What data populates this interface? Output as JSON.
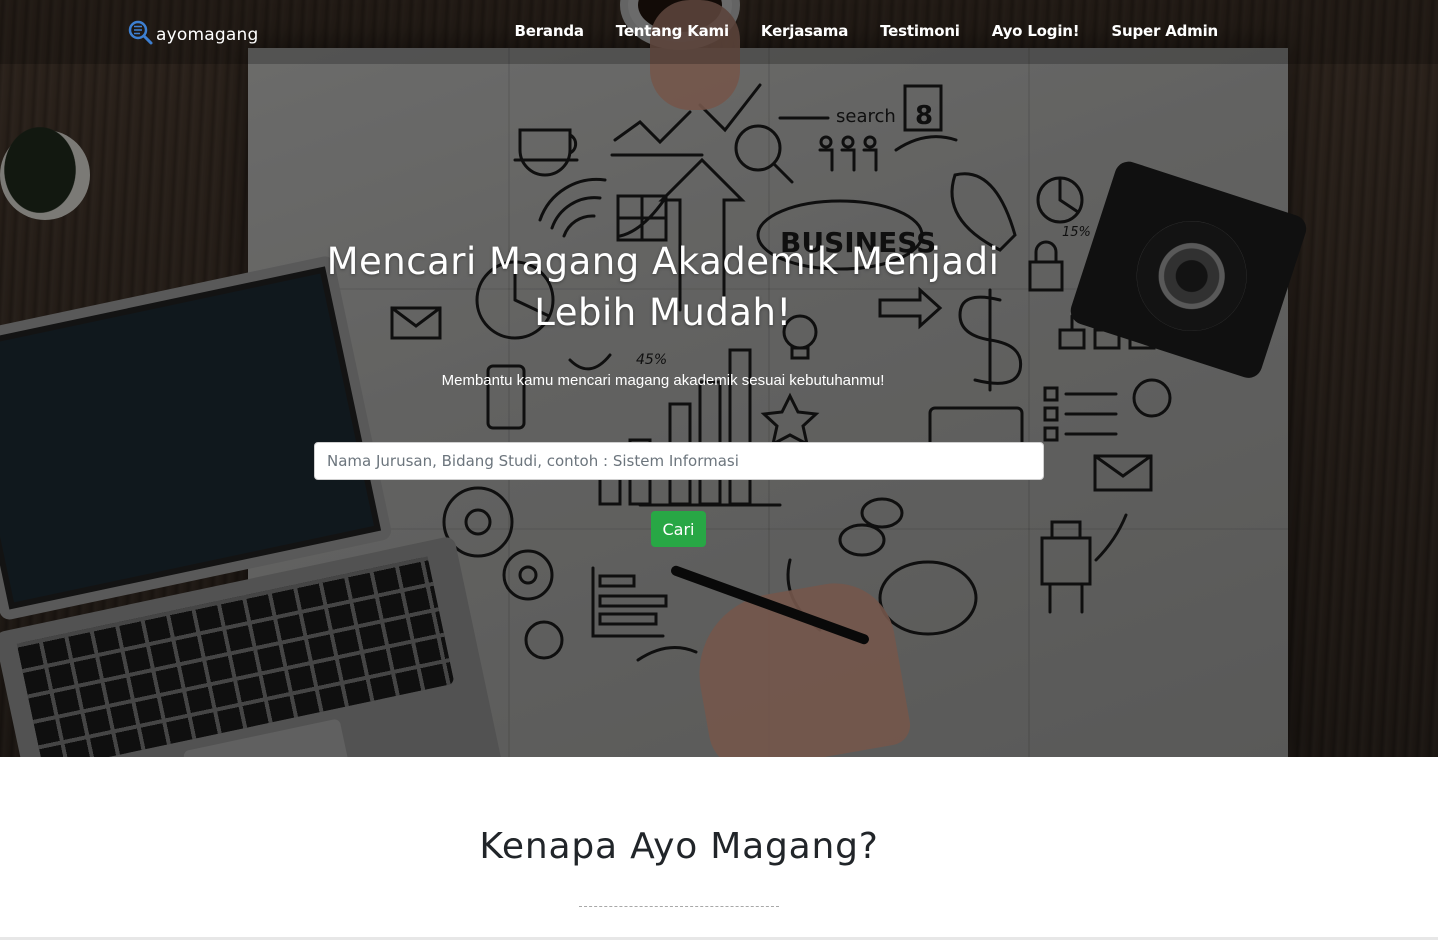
{
  "brand": {
    "name": "ayomagang"
  },
  "nav": {
    "items": [
      {
        "label": "Beranda"
      },
      {
        "label": "Tentang Kami"
      },
      {
        "label": "Kerjasama"
      },
      {
        "label": "Testimoni"
      },
      {
        "label": "Ayo Login!"
      },
      {
        "label": "Super Admin"
      }
    ]
  },
  "hero": {
    "title": "Mencari Magang Akademik Menjadi Lebih Mudah!",
    "subtitle": "Membantu kamu mencari magang akademik sesuai kebutuhanmu!",
    "search": {
      "placeholder": "Nama Jurusan, Bidang Studi, contoh : Sistem Informasi",
      "value": ""
    },
    "button_label": "Cari"
  },
  "section": {
    "title": "Kenapa Ayo Magang?"
  },
  "doodles": {
    "search_word": "search",
    "business_word": "BUSINESS",
    "calendar_number": "8",
    "percent_a": "45%",
    "percent_b": "15%"
  },
  "colors": {
    "accent_button": "#28a745",
    "text_light": "#ffffff",
    "heading_dark": "#212529"
  }
}
